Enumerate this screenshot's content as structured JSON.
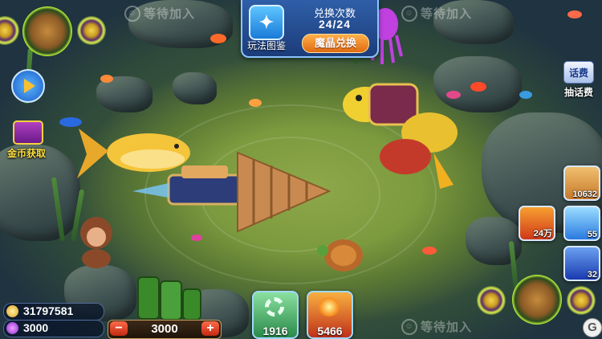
{
  "seat_waiting": {
    "top_left": "等待加入",
    "top_right": "等待加入",
    "bottom_right": "等待加入"
  },
  "top_panel": {
    "guide_label": "玩法图鉴",
    "exchange_title": "兑换次数",
    "exchange_count": "24/24",
    "redeem_button": "魔晶兑换"
  },
  "left_menu": {
    "gold_label": "金币获取"
  },
  "right_menu": {
    "phone_title": "话费",
    "phone_label": "抽话费"
  },
  "skills": [
    {
      "name": "lock-target-skill",
      "count": "10632",
      "color": "#d88a3a"
    },
    {
      "name": "fire-skill",
      "count": "24万",
      "color": "#e04a1a"
    },
    {
      "name": "freeze-skill",
      "count": "55",
      "color": "#2a8ae0"
    },
    {
      "name": "speed-skill",
      "count": "32",
      "color": "#2a5ad0"
    }
  ],
  "bottom_items": [
    {
      "name": "gear-item",
      "count": "1916",
      "color": "#3aa060"
    },
    {
      "name": "fire-burst-item",
      "count": "5466",
      "color": "#d04a2a"
    }
  ],
  "player": {
    "gold": "31797581",
    "gems": "3000",
    "bet": "3000",
    "minus": "−",
    "plus": "+"
  },
  "g_button": "G",
  "colors": {
    "panel": "#2f5fa8",
    "redeem": "#e06a10",
    "seabed": "#7c9a3e",
    "turret_glow": "#b9f03a"
  }
}
